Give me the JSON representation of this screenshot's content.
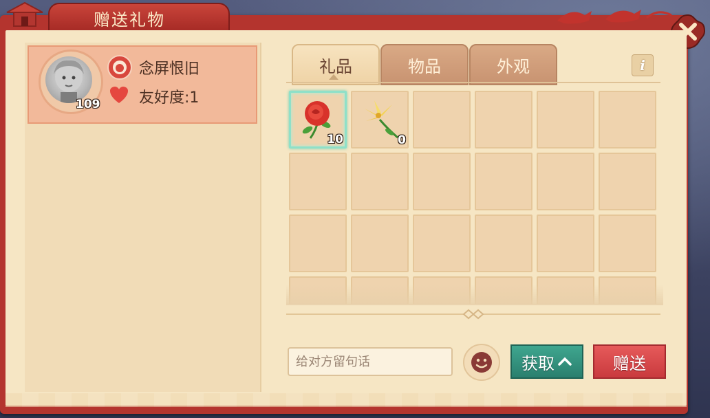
{
  "window": {
    "title": "赠送礼物"
  },
  "player": {
    "name": "念屏恨旧",
    "level": "109",
    "friendship_label": "友好度:1"
  },
  "tabs": [
    {
      "label": "礼品",
      "active": true
    },
    {
      "label": "物品",
      "active": false
    },
    {
      "label": "外观",
      "active": false
    }
  ],
  "inventory": {
    "items": [
      {
        "name": "rose",
        "count": "10",
        "selected": true
      },
      {
        "name": "lily",
        "count": "0",
        "selected": false
      }
    ],
    "columns": 6,
    "visible_rows": 4
  },
  "message": {
    "placeholder": "给对方留句话",
    "value": ""
  },
  "buttons": {
    "get_label": "获取",
    "gift_label": "赠送"
  },
  "colors": {
    "frame_red": "#b4342e",
    "panel_bg": "#f6e6c4",
    "card_bg": "#f2b99a",
    "get_button": "#2f8a76",
    "gift_button": "#d94a4d"
  }
}
